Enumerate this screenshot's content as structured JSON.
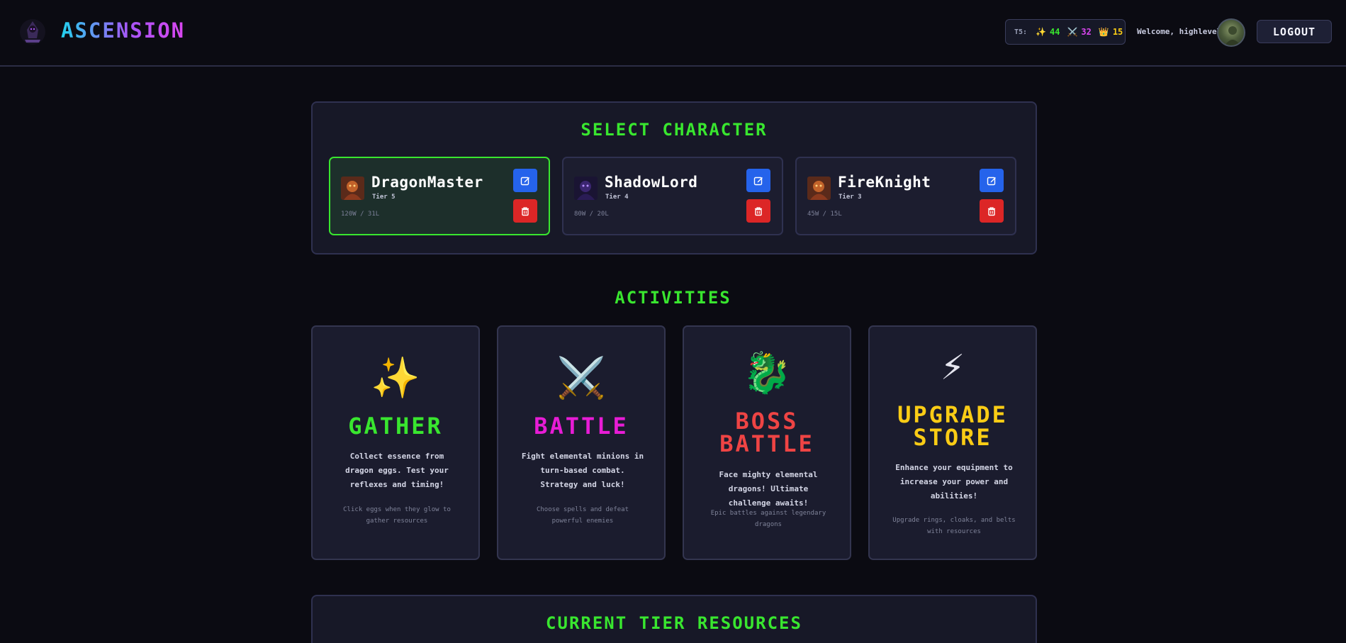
{
  "header": {
    "brand": "ASCENSION",
    "resources": {
      "label": "T5:",
      "items": [
        {
          "icon": "sparkle-icon",
          "glyph": "✨",
          "value": "44",
          "color": "#39e62f"
        },
        {
          "icon": "crossed-swords-icon",
          "glyph": "⚔️",
          "value": "32",
          "color": "#d946ef"
        },
        {
          "icon": "crown-icon",
          "glyph": "👑",
          "value": "15",
          "color": "#facc15"
        }
      ]
    },
    "welcome": "Welcome, highlevel",
    "logout_label": "LOGOUT"
  },
  "select_character": {
    "title": "SELECT CHARACTER",
    "characters": [
      {
        "name": "DragonMaster",
        "tier": "Tier 5",
        "stats": "120W / 31L",
        "selected": true
      },
      {
        "name": "ShadowLord",
        "tier": "Tier 4",
        "stats": "80W / 20L",
        "selected": false
      },
      {
        "name": "FireKnight",
        "tier": "Tier 3",
        "stats": "45W / 15L",
        "selected": false
      }
    ]
  },
  "activities": {
    "title": "ACTIVITIES",
    "cards": [
      {
        "icon": "sparkles-icon",
        "glyph": "✨",
        "title": "GATHER",
        "color": "#39e62f",
        "desc": "Collect essence from dragon eggs. Test your reflexes and timing!",
        "hint": "Click eggs when they glow to gather resources"
      },
      {
        "icon": "crossed-swords-icon",
        "glyph": "⚔️",
        "title": "BATTLE",
        "color": "#e81cd6",
        "desc": "Fight elemental minions in turn-based combat. Strategy and luck!",
        "hint": "Choose spells and defeat powerful enemies"
      },
      {
        "icon": "dragon-icon",
        "glyph": "🐉",
        "title": "BOSS BATTLE",
        "color": "#ef4444",
        "desc": "Face mighty elemental dragons! Ultimate challenge awaits!",
        "hint": "Epic battles against legendary dragons"
      },
      {
        "icon": "lightning-icon",
        "glyph": "⚡",
        "title": "UPGRADE STORE",
        "color": "#facc15",
        "desc": "Enhance your equipment to increase your power and abilities!",
        "hint": "Upgrade rings, cloaks, and belts with resources"
      }
    ]
  },
  "tier_resources": {
    "title": "CURRENT TIER RESOURCES"
  }
}
